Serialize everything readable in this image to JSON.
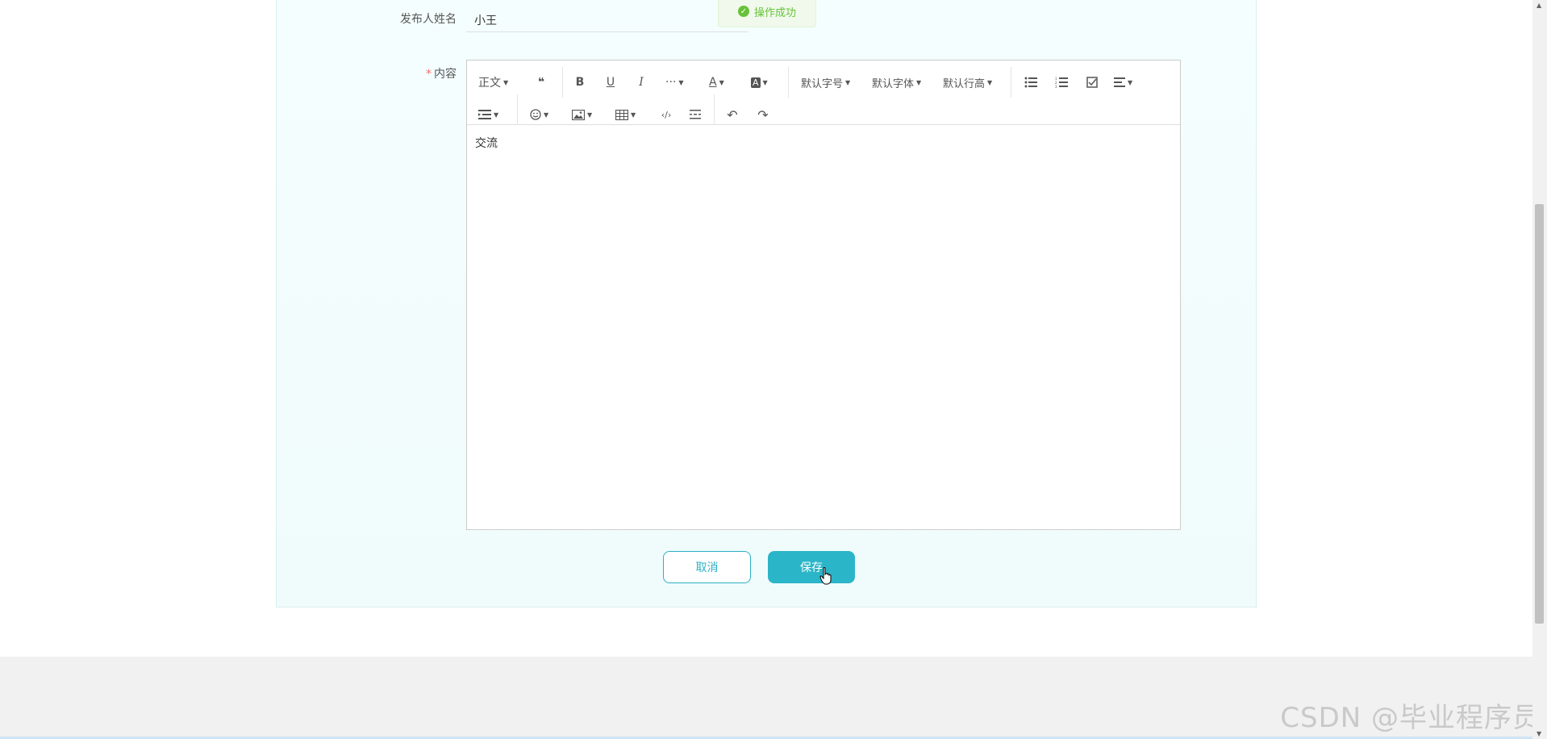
{
  "toast": {
    "text": "操作成功"
  },
  "form": {
    "publisher_label": "发布人姓名",
    "publisher_value": "小王",
    "content_label": "内容",
    "required_mark": "*"
  },
  "toolbar": {
    "paragraph": "正文",
    "more": "···",
    "font_size": "默认字号",
    "font_family": "默认字体",
    "line_height": "默认行高"
  },
  "editor": {
    "content": "交流"
  },
  "actions": {
    "cancel": "取消",
    "save": "保存"
  },
  "watermark": "CSDN @毕业程序员",
  "colors": {
    "accent": "#2bb5c8",
    "success": "#67c23a",
    "required": "#f56c6c"
  }
}
